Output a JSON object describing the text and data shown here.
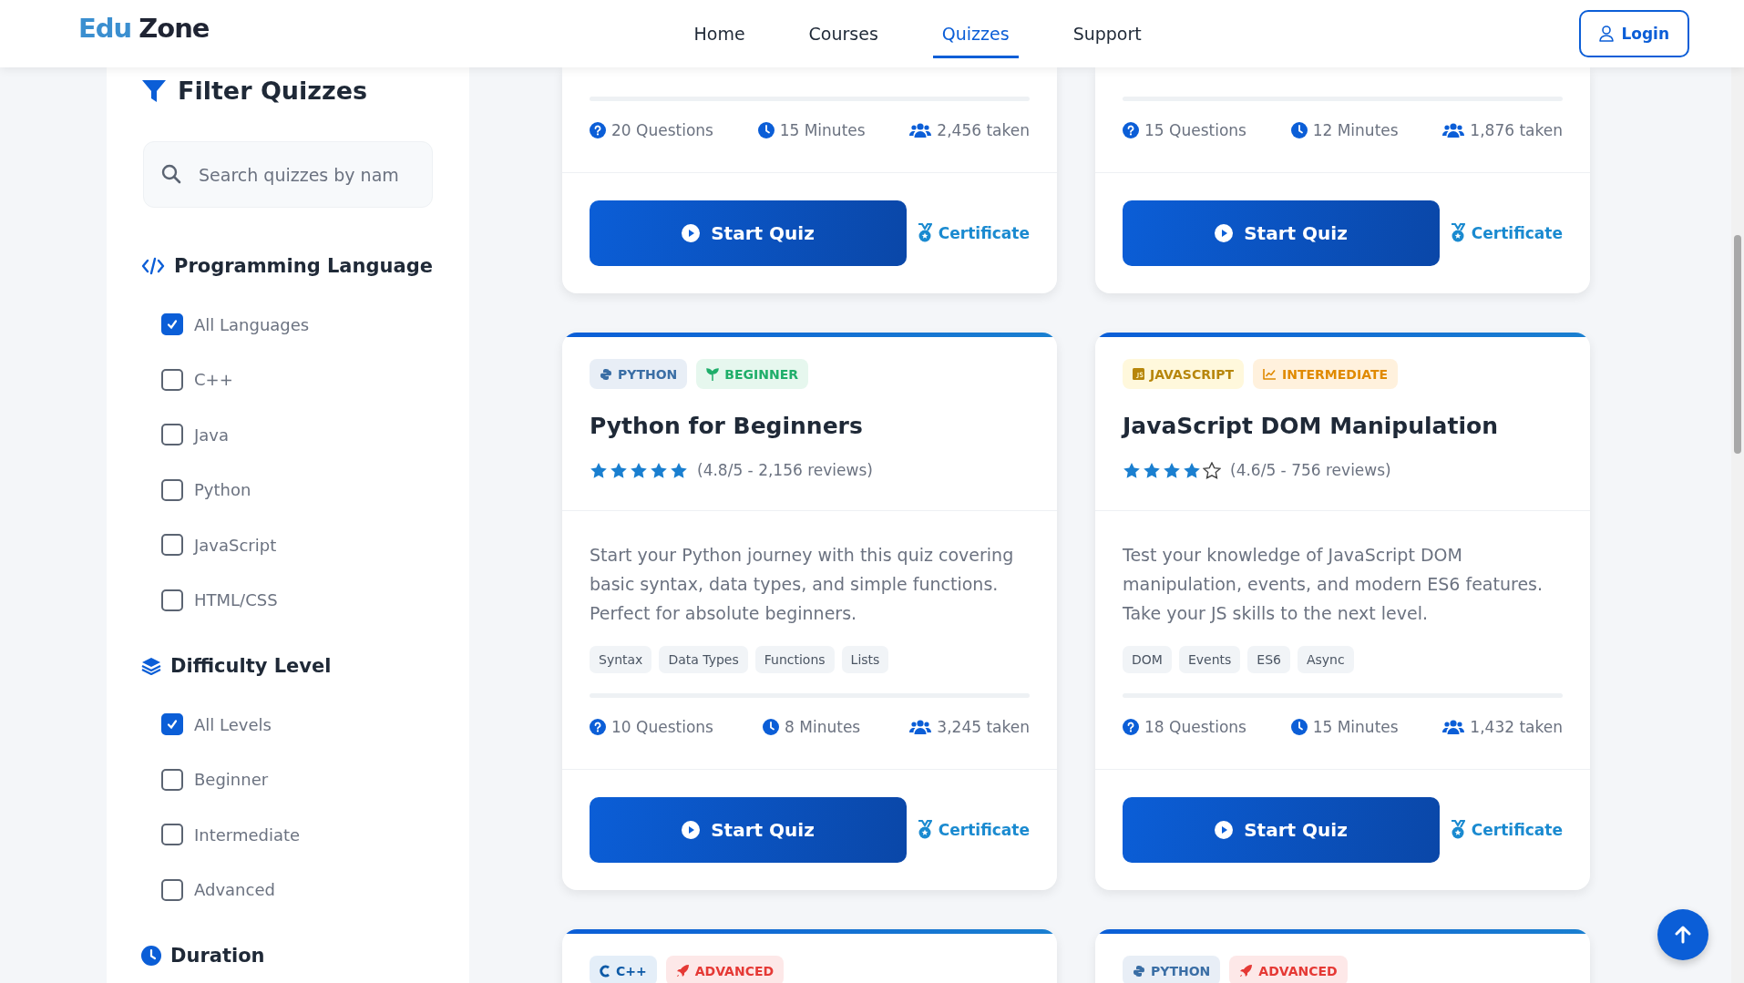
{
  "header": {
    "logo": {
      "first": "Edu",
      "second": "Zone"
    },
    "nav": [
      {
        "label": "Home",
        "selected": false
      },
      {
        "label": "Courses",
        "selected": false
      },
      {
        "label": "Quizzes",
        "selected": true
      },
      {
        "label": "Support",
        "selected": false
      }
    ],
    "login": "Login"
  },
  "sidebar": {
    "title": "Filter Quizzes",
    "search": {
      "placeholder": "Search quizzes by nam"
    },
    "sections": [
      {
        "heading": "Programming Language",
        "kind": "code",
        "options": [
          {
            "label": "All Languages",
            "checked": true
          },
          {
            "label": "C++",
            "checked": false
          },
          {
            "label": "Java",
            "checked": false
          },
          {
            "label": "Python",
            "checked": false
          },
          {
            "label": "JavaScript",
            "checked": false
          },
          {
            "label": "HTML/CSS",
            "checked": false
          }
        ]
      },
      {
        "heading": "Difficulty Level",
        "kind": "layers",
        "options": [
          {
            "label": "All Levels",
            "checked": true
          },
          {
            "label": "Beginner",
            "checked": false
          },
          {
            "label": "Intermediate",
            "checked": false
          },
          {
            "label": "Advanced",
            "checked": false
          }
        ]
      },
      {
        "heading": "Duration",
        "kind": "clock"
      }
    ]
  },
  "quizzes": [
    {
      "stats": [
        {
          "kind": "questions",
          "text": "20 Questions"
        },
        {
          "kind": "time",
          "text": "15 Minutes"
        },
        {
          "kind": "takers",
          "text": "2,456 taken"
        }
      ],
      "button": "Start Quiz",
      "certificate": "Certificate"
    },
    {
      "stats": [
        {
          "kind": "questions",
          "text": "15 Questions"
        },
        {
          "kind": "time",
          "text": "12 Minutes"
        },
        {
          "kind": "takers",
          "text": "1,876 taken"
        }
      ],
      "button": "Start Quiz",
      "certificate": "Certificate"
    },
    {
      "badges": [
        {
          "kind": "python",
          "text": "PYTHON"
        },
        {
          "kind": "beginner",
          "text": "BEGINNER"
        }
      ],
      "title": "Python for Beginners",
      "stars": 5,
      "rating": "(4.8/5 - 2,156 reviews)",
      "description": "Start your Python journey with this quiz covering basic syntax, data types, and simple functions. Perfect for absolute beginners.",
      "topics": [
        "Syntax",
        "Data Types",
        "Functions",
        "Lists"
      ],
      "stats": [
        {
          "kind": "questions",
          "text": "10 Questions"
        },
        {
          "kind": "time",
          "text": "8 Minutes"
        },
        {
          "kind": "takers",
          "text": "3,245 taken"
        }
      ],
      "button": "Start Quiz",
      "certificate": "Certificate"
    },
    {
      "badges": [
        {
          "kind": "javascript",
          "text": "JAVASCRIPT"
        },
        {
          "kind": "intermediate",
          "text": "INTERMEDIATE"
        }
      ],
      "title": "JavaScript DOM Manipulation",
      "stars": 4,
      "rating": "(4.6/5 - 756 reviews)",
      "description": "Test your knowledge of JavaScript DOM manipulation, events, and modern ES6 features. Take your JS skills to the next level.",
      "topics": [
        "DOM",
        "Events",
        "ES6",
        "Async"
      ],
      "stats": [
        {
          "kind": "questions",
          "text": "18 Questions"
        },
        {
          "kind": "time",
          "text": "15 Minutes"
        },
        {
          "kind": "takers",
          "text": "1,432 taken"
        }
      ],
      "button": "Start Quiz",
      "certificate": "Certificate"
    },
    {
      "badges": [
        {
          "kind": "cpp",
          "text": "C++"
        },
        {
          "kind": "advanced",
          "text": "ADVANCED"
        }
      ]
    },
    {
      "badges": [
        {
          "kind": "python",
          "text": "PYTHON"
        },
        {
          "kind": "advanced",
          "text": "ADVANCED"
        }
      ]
    }
  ]
}
